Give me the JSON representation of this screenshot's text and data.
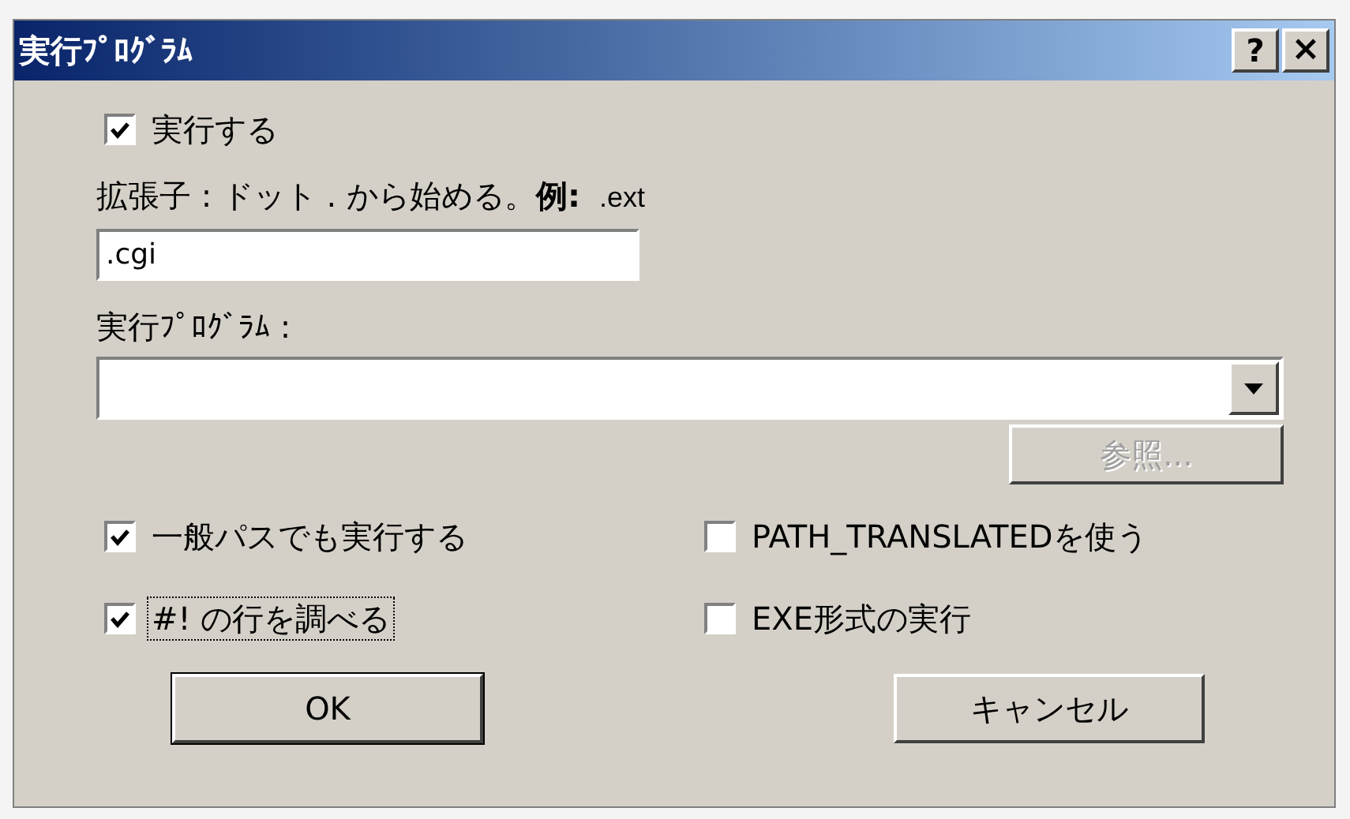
{
  "window": {
    "title": "実行ﾌﾟﾛｸﾞﾗﾑ",
    "help_button": "?",
    "close_button": "×"
  },
  "run": {
    "label": "実行する",
    "checked": true
  },
  "extension": {
    "label": "拡張子 : ドット . から始める。**例:**",
    "example": ".ext",
    "value": ".cgi"
  },
  "program": {
    "label": "実行ﾌﾟﾛｸﾞﾗﾑ :",
    "browse_button": "参照...",
    "browse_disabled": true
  },
  "options": [
    {
      "label": "一般パスでも実行する",
      "checked": true,
      "focused": false
    },
    {
      "label": "PATH_TRANSLATEDを使う",
      "checked": false,
      "focused": false
    },
    {
      "label": "#! の行を調べる",
      "checked": true,
      "focused": true
    },
    {
      "label": "EXE形式の実行",
      "checked": false,
      "focused": false
    }
  ],
  "buttons": [
    {
      "label": "OK",
      "default": true
    },
    {
      "label": "キャンセル",
      "default": false
    }
  ]
}
